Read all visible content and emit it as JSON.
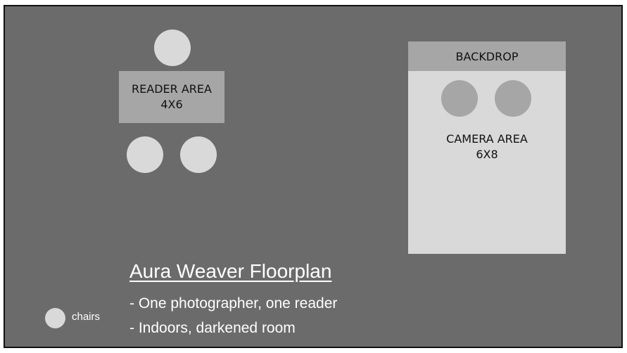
{
  "reader_area": {
    "line1": "READER AREA",
    "line2": "4X6"
  },
  "camera_area": {
    "backdrop_label": "BACKDROP",
    "line1": "CAMERA AREA",
    "line2": "6X8"
  },
  "title": "Aura Weaver Floorplan",
  "notes": [
    "- One photographer, one reader",
    "- Indoors, darkened room"
  ],
  "legend": {
    "chairs_label": "chairs"
  },
  "colors": {
    "floor": "#6b6b6b",
    "chair": "#d9d9d9",
    "area_dark": "#a6a6a6",
    "area_light": "#d9d9d9",
    "text_light": "#ffffff"
  }
}
